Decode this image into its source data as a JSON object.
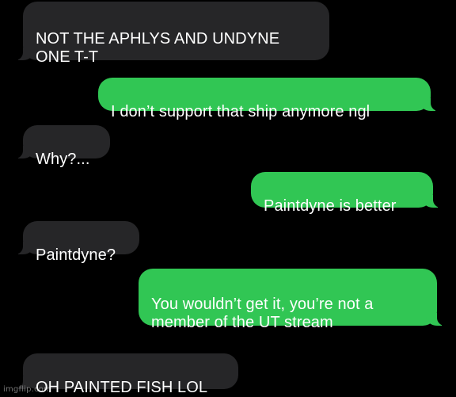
{
  "messages": [
    {
      "from": "them",
      "text": "NOT THE APHLYS AND UNDYNE\nONE T-T"
    },
    {
      "from": "me",
      "text": "I don’t support that ship anymore ngl"
    },
    {
      "from": "them",
      "text": "Why?..."
    },
    {
      "from": "me",
      "text": "Paintdyne is better"
    },
    {
      "from": "them",
      "text": "Paintdyne?"
    },
    {
      "from": "me",
      "text": "You wouldn’t get it, you’re not a\nmember of the UT stream"
    },
    {
      "from": "them",
      "text": "OH PAINTED FISH LOL"
    }
  ],
  "watermark": "imgflip.com",
  "colors": {
    "background": "#000000",
    "received_bubble": "#262628",
    "sent_bubble": "#31c654",
    "text": "#ffffff"
  }
}
